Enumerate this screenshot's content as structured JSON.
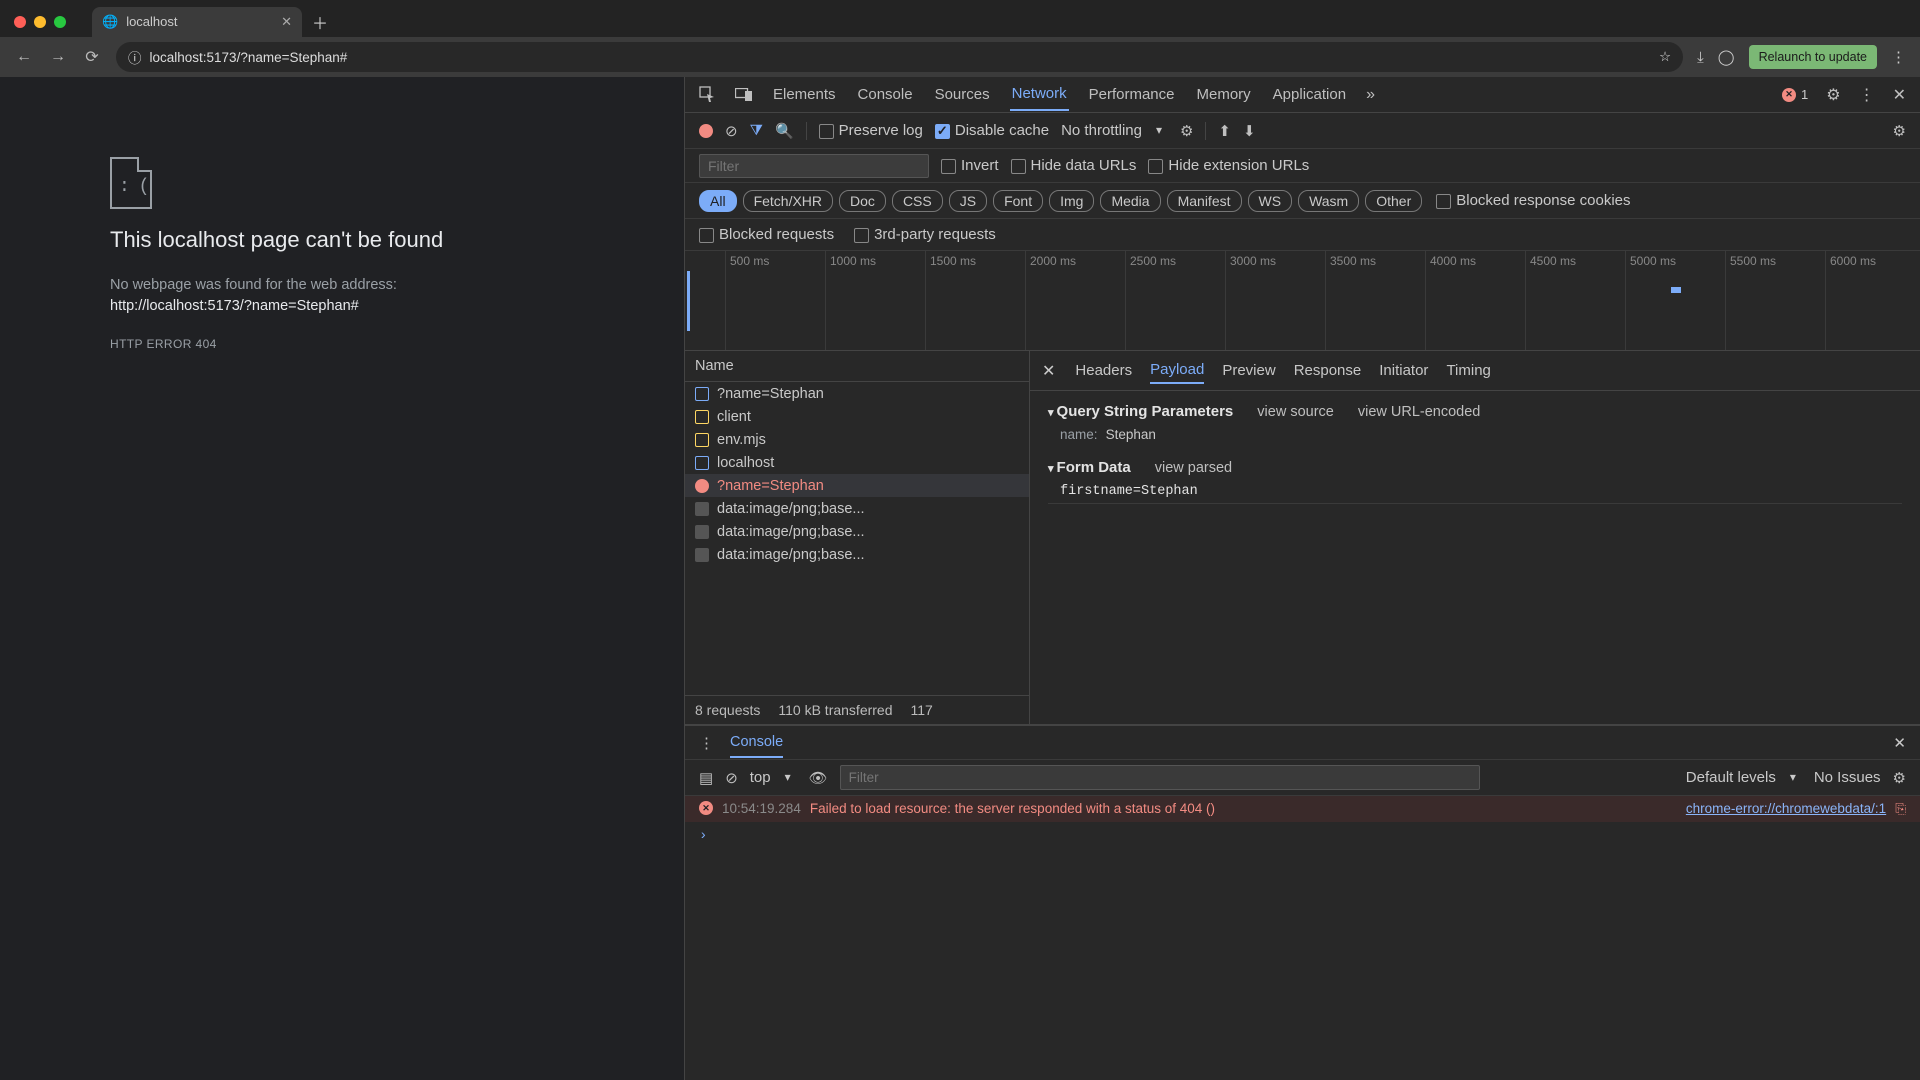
{
  "browser": {
    "tab_title": "localhost",
    "url": "localhost:5173/?name=Stephan#",
    "relaunch": "Relaunch to update"
  },
  "page": {
    "heading": "This localhost page can't be found",
    "msg": "No webpage was found for the web address:",
    "url": "http://localhost:5173/?name=Stephan#",
    "code": "HTTP ERROR 404"
  },
  "devtools": {
    "tabs": [
      "Elements",
      "Console",
      "Sources",
      "Network",
      "Performance",
      "Memory",
      "Application"
    ],
    "active_tab": "Network",
    "error_count": "1",
    "toolbar": {
      "preserve_log": "Preserve log",
      "disable_cache": "Disable cache",
      "throttling": "No throttling"
    },
    "filter": {
      "placeholder": "Filter",
      "invert": "Invert",
      "hide_data": "Hide data URLs",
      "hide_ext": "Hide extension URLs"
    },
    "types": [
      "All",
      "Fetch/XHR",
      "Doc",
      "CSS",
      "JS",
      "Font",
      "Img",
      "Media",
      "Manifest",
      "WS",
      "Wasm",
      "Other"
    ],
    "types_extra": "Blocked response cookies",
    "blocked_row": {
      "blocked": "Blocked requests",
      "third": "3rd-party requests"
    },
    "timeline_ticks": [
      "500 ms",
      "1000 ms",
      "1500 ms",
      "2000 ms",
      "2500 ms",
      "3000 ms",
      "3500 ms",
      "4000 ms",
      "4500 ms",
      "5000 ms",
      "5500 ms",
      "6000 ms"
    ],
    "list": {
      "header": "Name",
      "rows": [
        {
          "i": "doc",
          "n": "?name=Stephan"
        },
        {
          "i": "js",
          "n": "client"
        },
        {
          "i": "js",
          "n": "env.mjs"
        },
        {
          "i": "doc",
          "n": "localhost"
        },
        {
          "i": "err",
          "n": "?name=Stephan"
        },
        {
          "i": "img",
          "n": "data:image/png;base..."
        },
        {
          "i": "img",
          "n": "data:image/png;base..."
        },
        {
          "i": "img",
          "n": "data:image/png;base..."
        }
      ],
      "selected": 4,
      "footer": {
        "a": "8 requests",
        "b": "110 kB transferred",
        "c": "117"
      }
    },
    "detail": {
      "tabs": [
        "Headers",
        "Payload",
        "Preview",
        "Response",
        "Initiator",
        "Timing"
      ],
      "active": "Payload",
      "qsp": {
        "title": "Query String Parameters",
        "l1": "view source",
        "l2": "view URL-encoded",
        "key": "name:",
        "value": "Stephan"
      },
      "form": {
        "title": "Form Data",
        "l1": "view parsed",
        "raw": "firstname=Stephan"
      }
    },
    "console": {
      "tab": "Console",
      "ctx": "top",
      "placeholder": "Filter",
      "levels": "Default levels",
      "issues": "No Issues",
      "msg": {
        "ts": "10:54:19.284",
        "text": "Failed to load resource: the server responded with a status of 404 ()",
        "src": "chrome-error://chromewebdata/:1"
      }
    }
  }
}
